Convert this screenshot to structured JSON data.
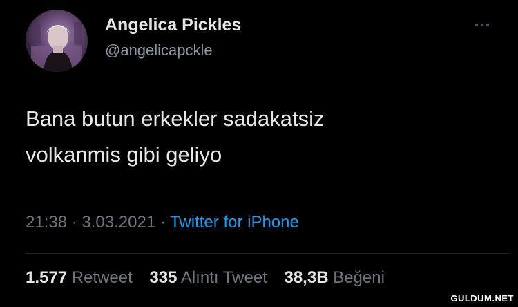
{
  "user": {
    "display_name": "Angelica Pickles",
    "handle": "@angelicapckle",
    "avatar_icon": "profile-photo"
  },
  "tweet": {
    "lines": [
      "Bana butun erkekler sadakatsiz",
      "volkanmis gibi geliyo"
    ],
    "time": "21:38",
    "separator": "·",
    "date": "3.03.2021",
    "source": "Twitter for iPhone"
  },
  "stats": {
    "retweets": {
      "count": "1.577",
      "label": "Retweet"
    },
    "quotes": {
      "count": "335",
      "label": "Alıntı Tweet"
    },
    "likes": {
      "count": "38,3B",
      "label": "Beğeni"
    }
  },
  "more_icon": "more-horizontal-icon",
  "watermark": "GULDUM.NET",
  "colors": {
    "background": "#000000",
    "link": "#1d9bf0",
    "muted": "#6e767d",
    "text": "#e8e8e8"
  }
}
